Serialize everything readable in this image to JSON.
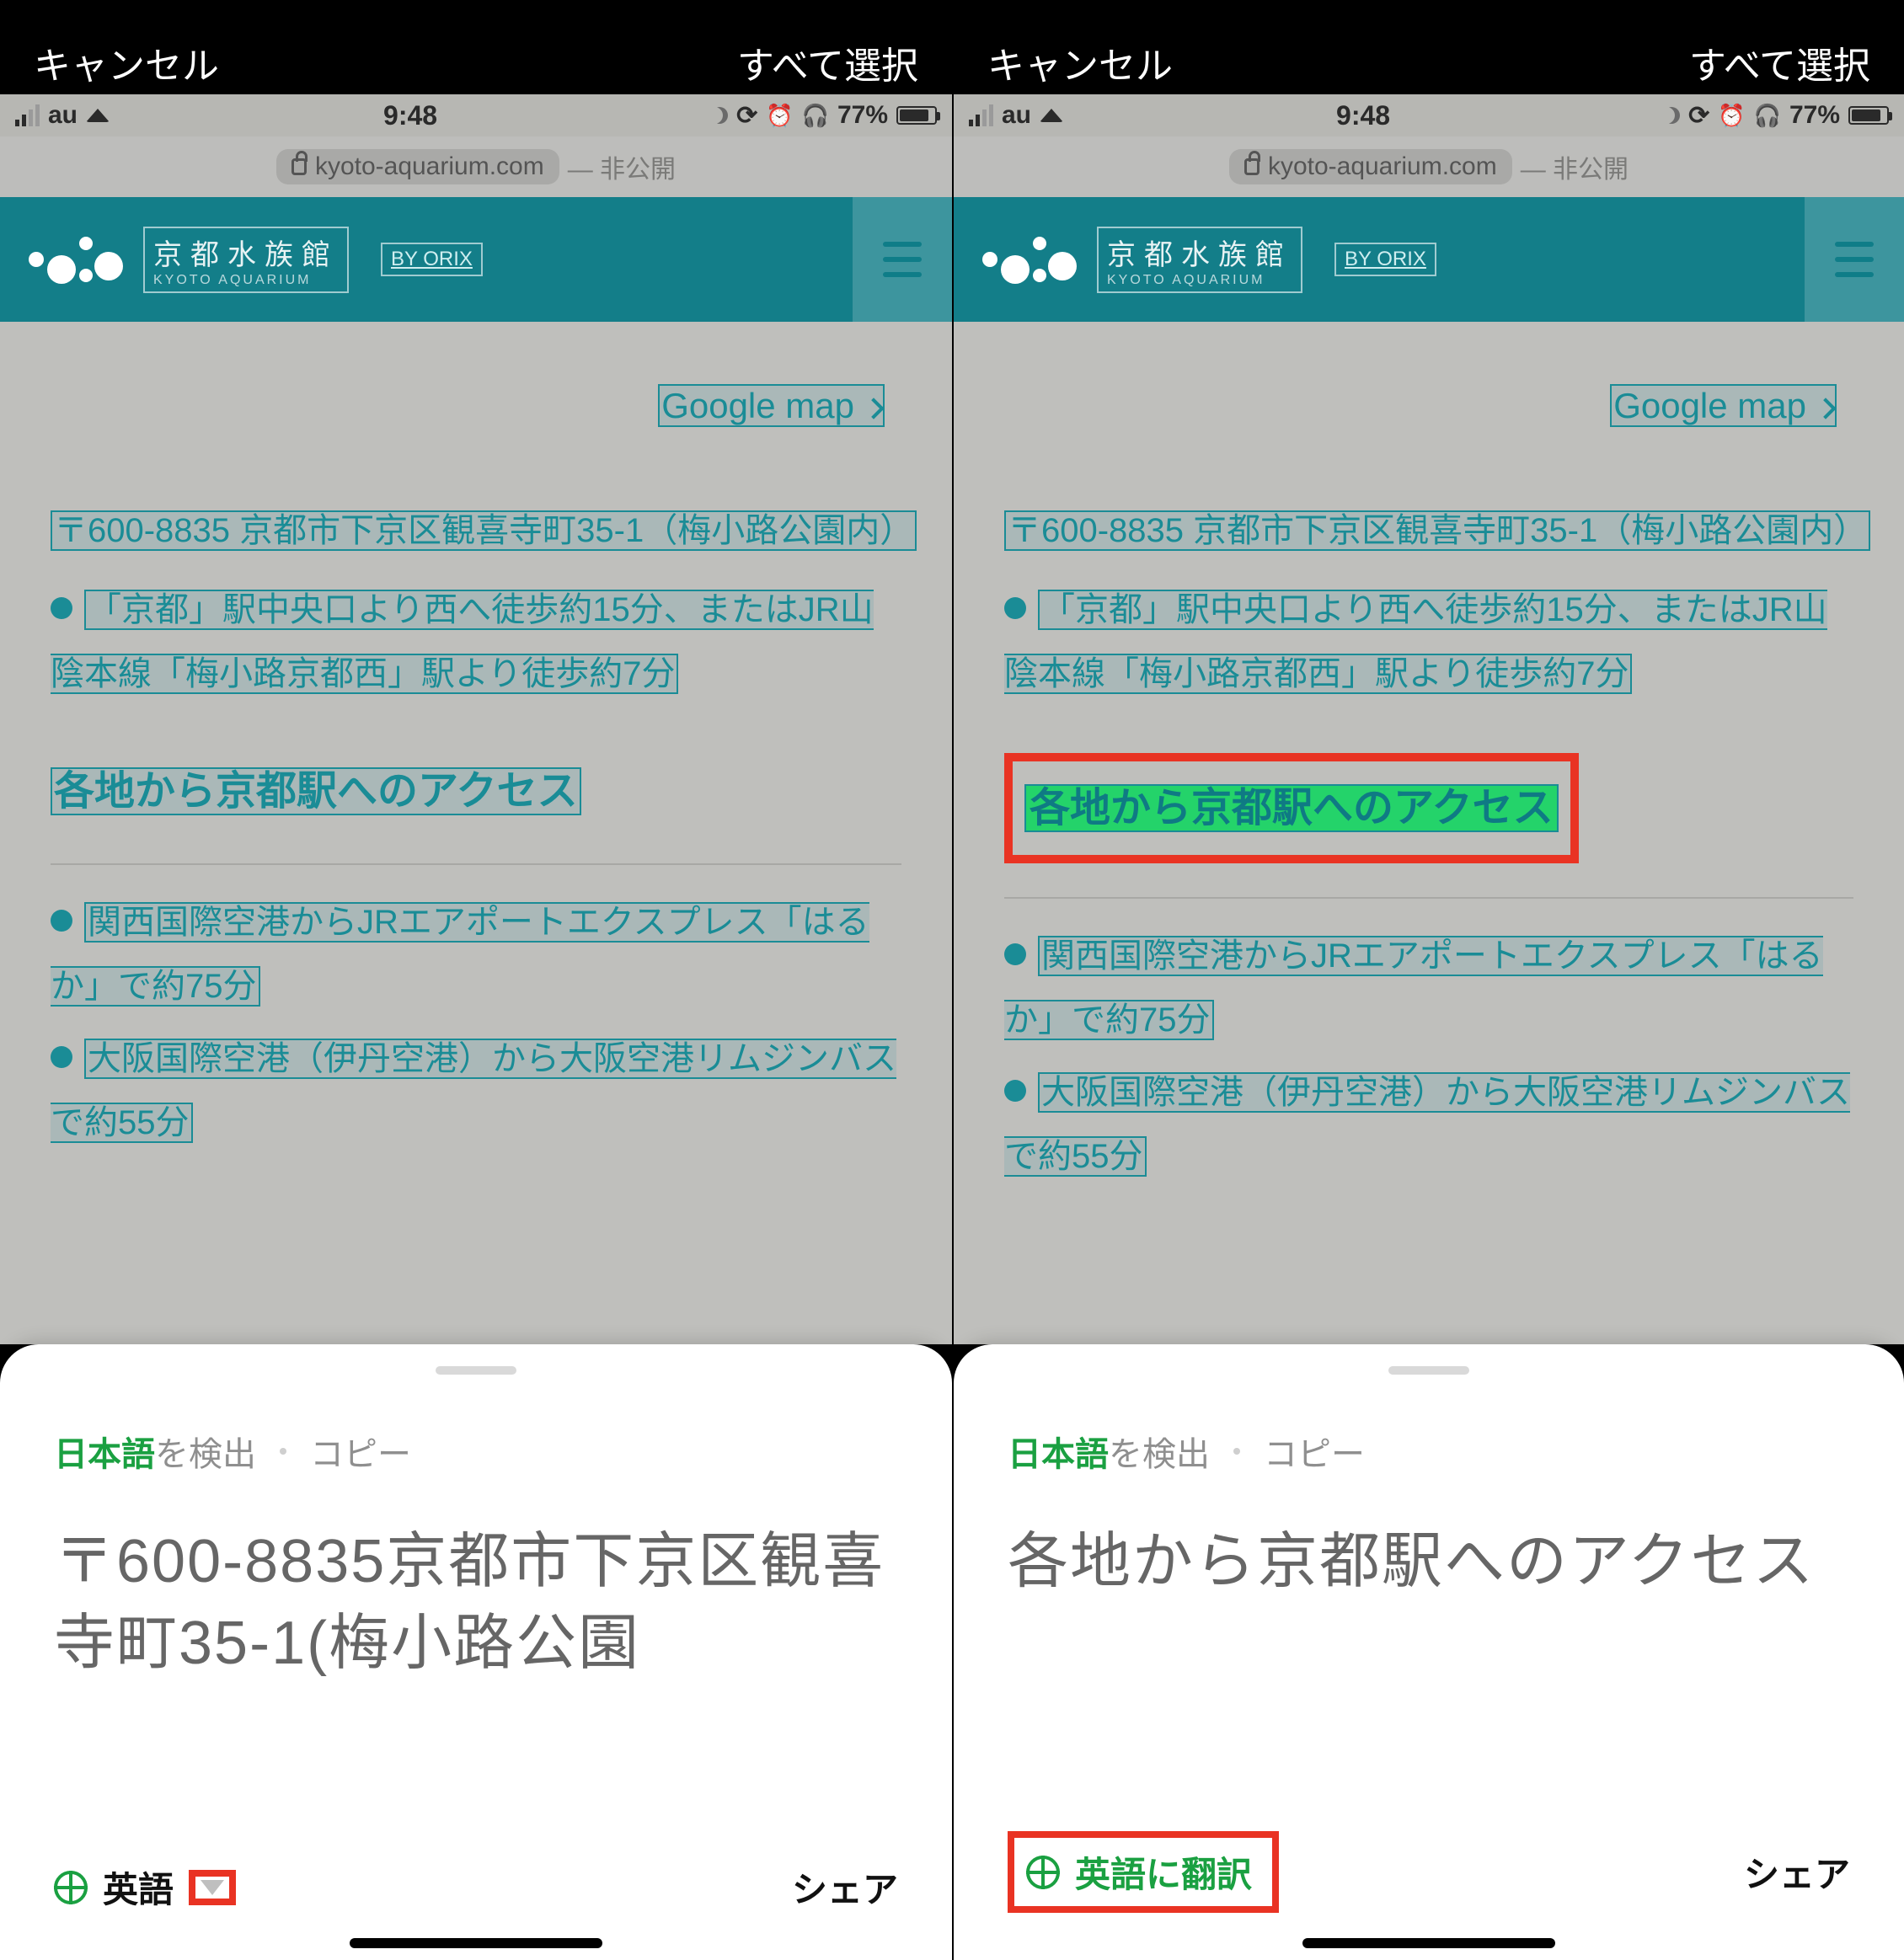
{
  "topbar": {
    "cancel": "キャンセル",
    "select_all": "すべて選択"
  },
  "statusbar": {
    "carrier": "au",
    "time": "9:48",
    "battery_pct": "77%"
  },
  "addressbar": {
    "domain": "kyoto-aquarium.com",
    "privacy": "— 非公開"
  },
  "siteheader": {
    "title_jp": "京都水族館",
    "title_en": "KYOTO AQUARIUM",
    "byorix": "BY ORIX"
  },
  "page": {
    "google_map": "Google map",
    "address": "〒600-8835 京都市下京区観喜寺町35-1（梅小路公園内）",
    "access1": "「京都」駅中央口より西へ徒歩約15分、またはJR山陰本線「梅小路京都西」駅より徒歩約7分",
    "heading_access": "各地から京都駅へのアクセス",
    "airport1": "関西国際空港からJRエアポートエクスプレス「はるか」で約75分",
    "airport2": "大阪国際空港（伊丹空港）から大阪空港リムジンバスで約55分"
  },
  "sheet_left": {
    "detected_lang": "日本語",
    "detected_suffix": "を検出",
    "copy": "コピー",
    "preview": "〒600-8835京都市下京区観喜寺町35-1(梅小路公園",
    "target_lang": "英語",
    "share": "シェア"
  },
  "sheet_right": {
    "detected_lang": "日本語",
    "detected_suffix": "を検出",
    "copy": "コピー",
    "preview": "各地から京都駅へのアクセス",
    "translate_btn": "英語に翻訳",
    "share": "シェア"
  }
}
